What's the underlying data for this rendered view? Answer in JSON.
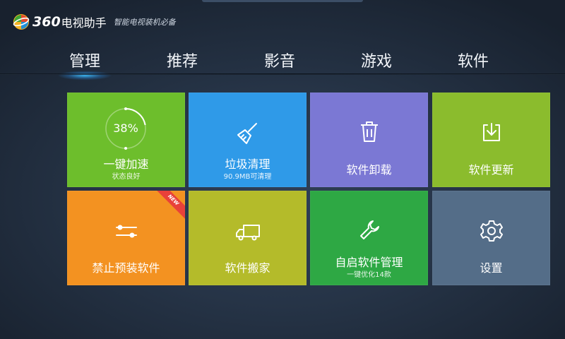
{
  "app": {
    "number": "360",
    "name": "电视助手",
    "slogan": "智能电视装机必备"
  },
  "tabs": [
    {
      "label": "管理",
      "active": true
    },
    {
      "label": "推荐",
      "active": false
    },
    {
      "label": "影音",
      "active": false
    },
    {
      "label": "游戏",
      "active": false
    },
    {
      "label": "软件",
      "active": false
    }
  ],
  "tiles": {
    "boost": {
      "title": "一键加速",
      "subtitle": "状态良好",
      "percent": "38%",
      "color": "#6dbe2c"
    },
    "clean": {
      "title": "垃圾清理",
      "subtitle": "90.9MB可清理",
      "icon": "broom-icon",
      "color": "#2f9ae8"
    },
    "uninstall": {
      "title": "软件卸载",
      "icon": "trash-icon",
      "color": "#7b78d4"
    },
    "update": {
      "title": "软件更新",
      "icon": "download-icon",
      "color": "#8bbc2d"
    },
    "block": {
      "title": "禁止预装软件",
      "badge": "NEW",
      "icon": "toggle-lines-icon",
      "color": "#f39221"
    },
    "move": {
      "title": "软件搬家",
      "icon": "truck-icon",
      "color": "#b4bb2a"
    },
    "autostart": {
      "title": "自启软件管理",
      "subtitle": "一键优化14款",
      "icon": "wrench-icon",
      "color": "#2ea844"
    },
    "settings": {
      "title": "设置",
      "icon": "gear-icon",
      "color": "#546d88"
    }
  }
}
